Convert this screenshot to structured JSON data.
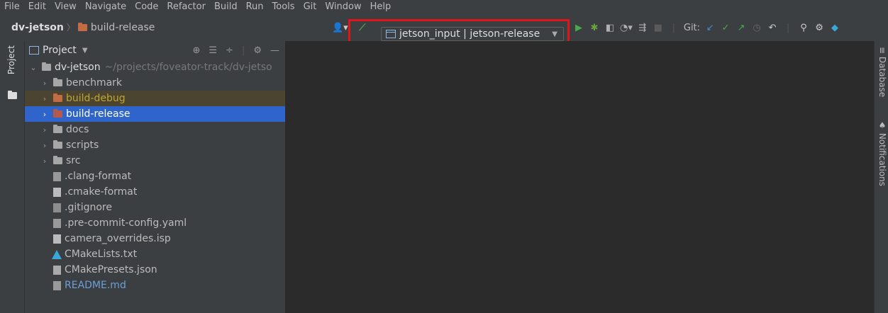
{
  "menu": [
    "File",
    "Edit",
    "View",
    "Navigate",
    "Code",
    "Refactor",
    "Build",
    "Run",
    "Tools",
    "Git",
    "Window",
    "Help"
  ],
  "breadcrumb": {
    "project": "dv-jetson",
    "folder": "build-release"
  },
  "toolbar": {
    "run_config": "jetson_input | jetson-release",
    "git_label": "Git:"
  },
  "project_panel": {
    "title": "Project",
    "root": {
      "name": "dv-jetson",
      "path": "~/projects/foveator-track/dv-jetso"
    },
    "items": [
      {
        "label": "benchmark",
        "kind": "folder"
      },
      {
        "label": "build-debug",
        "kind": "folder-excluded"
      },
      {
        "label": "build-release",
        "kind": "folder-excluded",
        "selected": true
      },
      {
        "label": "docs",
        "kind": "folder"
      },
      {
        "label": "scripts",
        "kind": "folder"
      },
      {
        "label": "src",
        "kind": "folder"
      },
      {
        "label": ".clang-format",
        "kind": "file"
      },
      {
        "label": ".cmake-format",
        "kind": "file"
      },
      {
        "label": ".gitignore",
        "kind": "file"
      },
      {
        "label": ".pre-commit-config.yaml",
        "kind": "file"
      },
      {
        "label": "camera_overrides.isp",
        "kind": "file"
      },
      {
        "label": "CMakeLists.txt",
        "kind": "cmake"
      },
      {
        "label": "CMakePresets.json",
        "kind": "file"
      },
      {
        "label": "README.md",
        "kind": "markdown"
      }
    ]
  },
  "side_tabs": {
    "left": "Project",
    "right_database": "Database",
    "right_notifications": "Notifications"
  },
  "colors": {
    "highlight": "#e0151a",
    "selection": "#2f65ca",
    "accent_green": "#49a84b"
  }
}
